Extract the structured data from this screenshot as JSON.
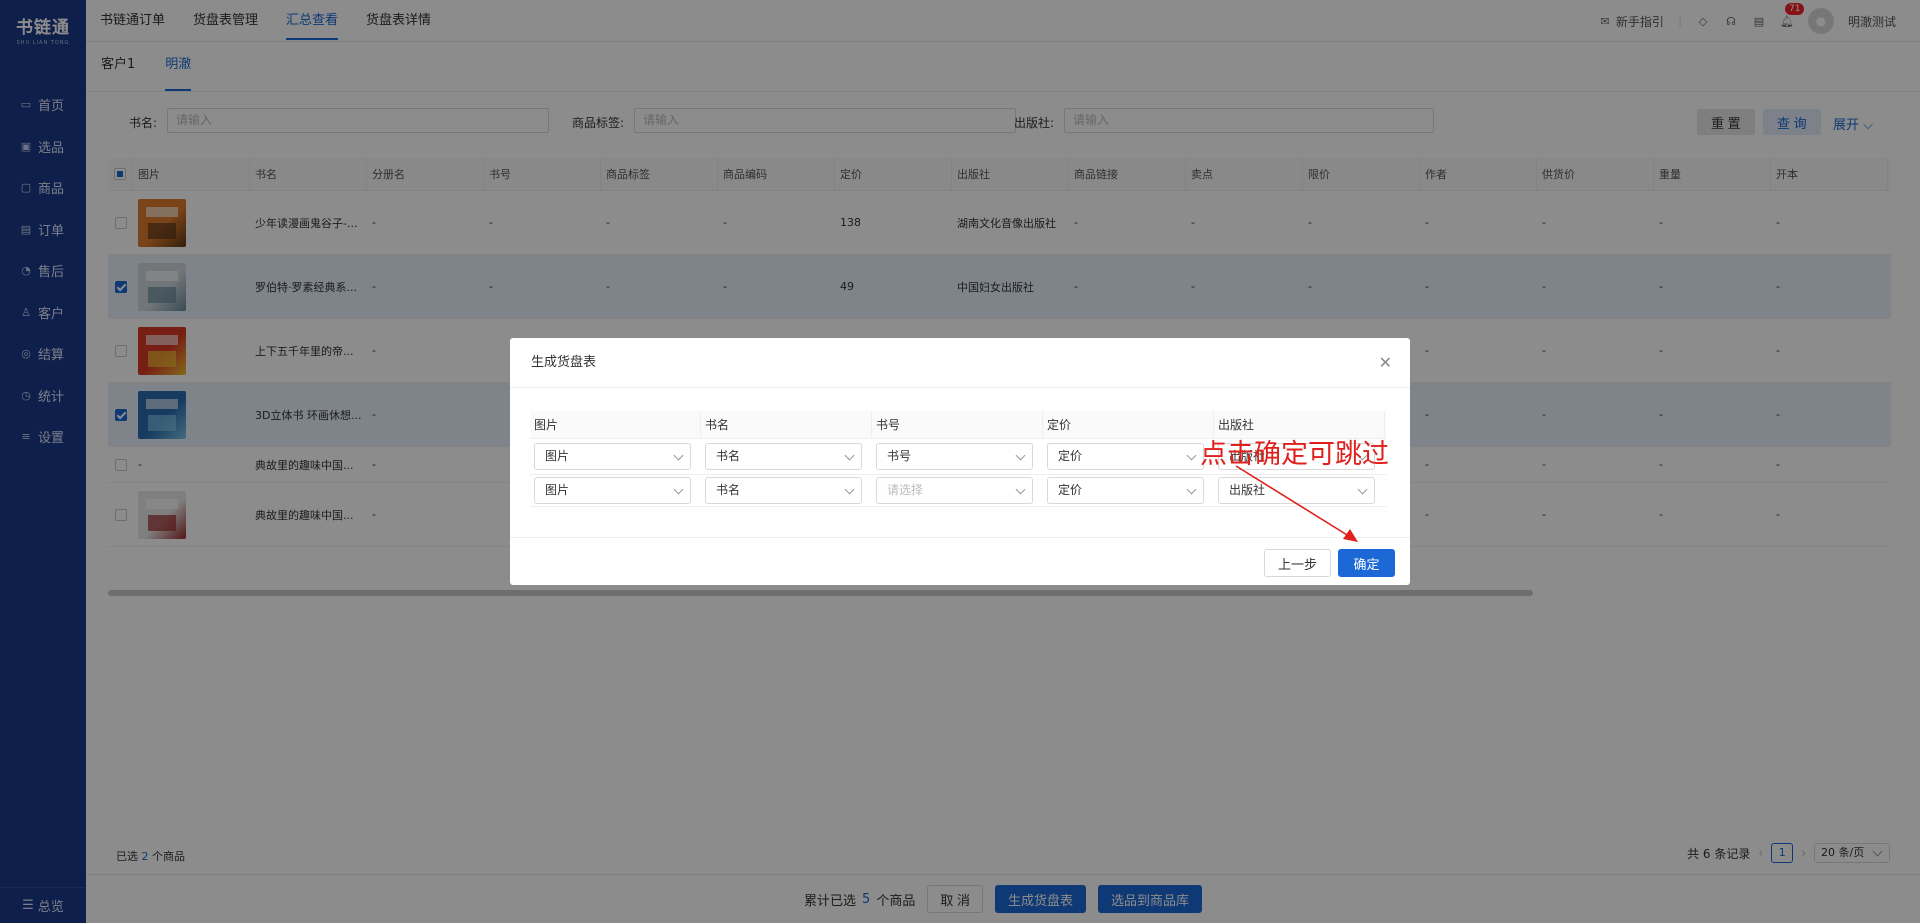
{
  "sidebar": {
    "logo": "书链通",
    "logo_sub": "SHU LIAN TONG",
    "items": [
      {
        "label": "首页",
        "icon": "monitor-icon"
      },
      {
        "label": "选品",
        "icon": "select-icon"
      },
      {
        "label": "商品",
        "icon": "goods-icon"
      },
      {
        "label": "订单",
        "icon": "order-icon"
      },
      {
        "label": "售后",
        "icon": "aftersale-icon"
      },
      {
        "label": "客户",
        "icon": "customer-icon"
      },
      {
        "label": "结算",
        "icon": "settle-icon"
      },
      {
        "label": "统计",
        "icon": "stats-icon"
      },
      {
        "label": "设置",
        "icon": "settings-icon"
      }
    ],
    "footer": "总览"
  },
  "topbar": {
    "tabs": [
      "书链通订单",
      "货盘表管理",
      "汇总查看",
      "货盘表详情"
    ],
    "active_tab": "汇总查看",
    "guide": "新手指引",
    "badge": "71",
    "username": "明澈测试"
  },
  "subtabs": {
    "items": [
      "客户1",
      "明澈"
    ],
    "active": "明澈"
  },
  "filter": {
    "book_label": "书名:",
    "book_placeholder": "请输入",
    "tag_label": "商品标签:",
    "tag_placeholder": "请输入",
    "publisher_label": "出版社:",
    "publisher_placeholder": "请输入",
    "reset": "重 置",
    "query": "查 询",
    "expand": "展开"
  },
  "table": {
    "columns": [
      "图片",
      "书名",
      "分册名",
      "书号",
      "商品标签",
      "商品编码",
      "定价",
      "出版社",
      "商品链接",
      "卖点",
      "限价",
      "作者",
      "供货价",
      "重量",
      "开本"
    ],
    "rows": [
      {
        "checked": false,
        "image": true,
        "name": "少年读漫画鬼谷子-...",
        "subtitle": "-",
        "isbn": "-",
        "tag": "-",
        "code": "-",
        "price": "138",
        "publisher": "湖南文化音像出版社",
        "link": "-",
        "point": "-",
        "limit": "-",
        "author": "-",
        "supply": "-",
        "weight": "-",
        "format": "-"
      },
      {
        "checked": true,
        "image": true,
        "name": "罗伯特·罗素经典系...",
        "subtitle": "-",
        "isbn": "-",
        "tag": "-",
        "code": "-",
        "price": "49",
        "publisher": "中国妇女出版社",
        "link": "-",
        "point": "-",
        "limit": "-",
        "author": "-",
        "supply": "-",
        "weight": "-",
        "format": "-"
      },
      {
        "checked": false,
        "image": true,
        "name": "上下五千年里的帝...",
        "subtitle": "-",
        "isbn": "",
        "tag": "",
        "code": "",
        "price": "",
        "publisher": "",
        "link": "",
        "point": "",
        "limit": "",
        "author": "-",
        "supply": "-",
        "weight": "-",
        "format": "-"
      },
      {
        "checked": true,
        "image": true,
        "name": "3D立体书 环画休想...",
        "subtitle": "-",
        "isbn": "",
        "tag": "",
        "code": "",
        "price": "",
        "publisher": "",
        "link": "",
        "point": "",
        "limit": "",
        "author": "-",
        "supply": "-",
        "weight": "-",
        "format": "-"
      },
      {
        "checked": false,
        "image": false,
        "image_text": "-",
        "name": "典故里的趣味中国...",
        "subtitle": "-",
        "isbn": "",
        "tag": "",
        "code": "",
        "price": "",
        "publisher": "",
        "link": "",
        "point": "",
        "limit": "",
        "author": "-",
        "supply": "-",
        "weight": "-",
        "format": "-"
      },
      {
        "checked": false,
        "image": true,
        "name": "典故里的趣味中国...",
        "subtitle": "-",
        "isbn": "",
        "tag": "",
        "code": "",
        "price": "",
        "publisher": "",
        "link": "",
        "point": "",
        "limit": "",
        "author": "-",
        "supply": "-",
        "weight": "-",
        "format": "-"
      }
    ]
  },
  "selection": {
    "prefix": "已选",
    "count": "2",
    "suffix": "个商品"
  },
  "pager": {
    "total": "共 6 条记录",
    "page": "1",
    "size": "20 条/页"
  },
  "bottom_bar": {
    "prefix": "累计已选",
    "count": "5",
    "suffix": "个商品",
    "cancel": "取 消",
    "generate": "生成货盘表",
    "to_library": "选品到商品库"
  },
  "modal": {
    "title": "生成货盘表",
    "columns": [
      "图片",
      "书名",
      "书号",
      "定价",
      "出版社"
    ],
    "rows": [
      [
        {
          "value": "图片",
          "placeholder": false
        },
        {
          "value": "书名",
          "placeholder": false
        },
        {
          "value": "书号",
          "placeholder": false
        },
        {
          "value": "定价",
          "placeholder": false
        },
        {
          "value": "出版社",
          "placeholder": false
        }
      ],
      [
        {
          "value": "图片",
          "placeholder": false
        },
        {
          "value": "书名",
          "placeholder": false
        },
        {
          "value": "请选择",
          "placeholder": true
        },
        {
          "value": "定价",
          "placeholder": false
        },
        {
          "value": "出版社",
          "placeholder": false
        }
      ]
    ],
    "prev": "上一步",
    "ok": "确定"
  },
  "annotation": {
    "text": "点击确定可跳过",
    "color": "#e0201c"
  },
  "colors": {
    "sidebar": "#1d3a8a",
    "accent": "#1b68d6"
  }
}
